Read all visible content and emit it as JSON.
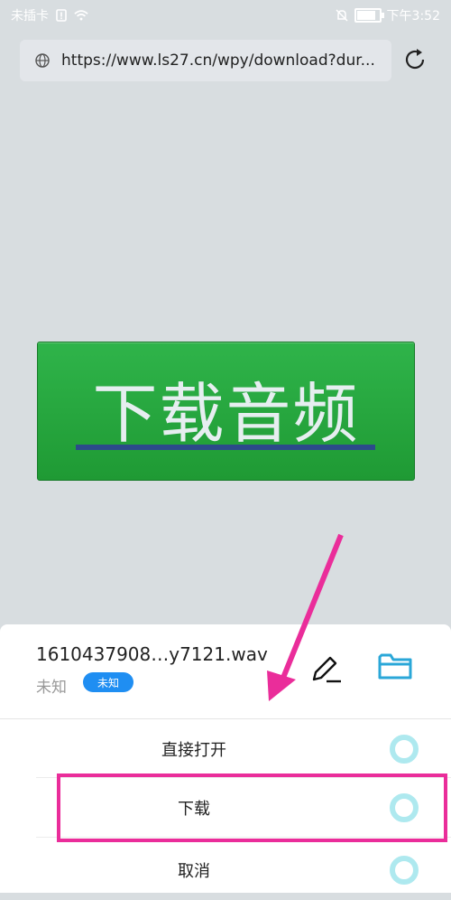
{
  "status_bar": {
    "left_text": "未插卡",
    "right_time": "下午3:52"
  },
  "url_bar": {
    "url": "https://www.ls27.cn/wpy/download?dur..."
  },
  "page": {
    "download_button_text": "下载音频"
  },
  "sheet": {
    "file_name": "1610437908…y7121.wav",
    "meta_label": "未知",
    "badge_label": "未知",
    "options": [
      {
        "label": "直接打开"
      },
      {
        "label": "下载"
      },
      {
        "label": "取消"
      }
    ]
  },
  "colors": {
    "accent_pink": "#ea2d9a",
    "badge_blue": "#1f8ef2",
    "banner_green": "#2fb44a",
    "radio_cyan": "#aee9ef"
  },
  "icons": {
    "sim": "sim-alert-icon",
    "wifi": "wifi-icon",
    "mute": "bell-off-icon",
    "battery": "battery-icon",
    "globe": "globe-icon",
    "refresh": "refresh-icon",
    "edit": "edit-icon",
    "folder": "folder-icon"
  }
}
